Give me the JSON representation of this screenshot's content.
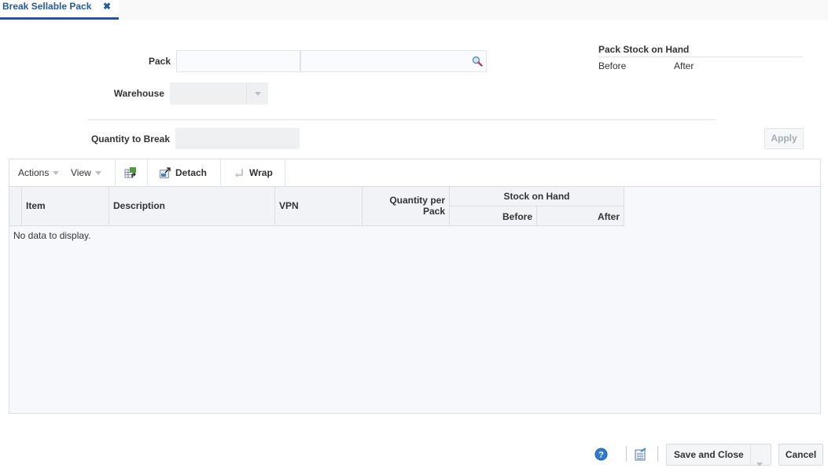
{
  "tab": {
    "label": "Break Sellable Pack",
    "close_icon": "close-icon"
  },
  "form": {
    "pack_label": "Pack",
    "pack_value": "",
    "pack_description": "",
    "warehouse_label": "Warehouse",
    "warehouse_value": "",
    "quantity_label": "Quantity to Break",
    "quantity_value": ""
  },
  "pack_stock": {
    "title": "Pack Stock on Hand",
    "before_label": "Before",
    "after_label": "After"
  },
  "apply_label": "Apply",
  "toolbar": {
    "actions_label": "Actions",
    "view_label": "View",
    "export_icon": "export-to-excel-icon",
    "detach_label": "Detach",
    "wrap_label": "Wrap"
  },
  "table": {
    "columns": {
      "item": "Item",
      "description": "Description",
      "vpn": "VPN",
      "qty_per_pack": "Quantity per Pack",
      "soh_group": "Stock on Hand",
      "soh_before": "Before",
      "soh_after": "After"
    },
    "rows": [],
    "empty_text": "No data to display."
  },
  "footer": {
    "help_icon": "help-icon",
    "notes_icon": "notes-icon",
    "save_close_label": "Save and Close",
    "cancel_label": "Cancel"
  }
}
